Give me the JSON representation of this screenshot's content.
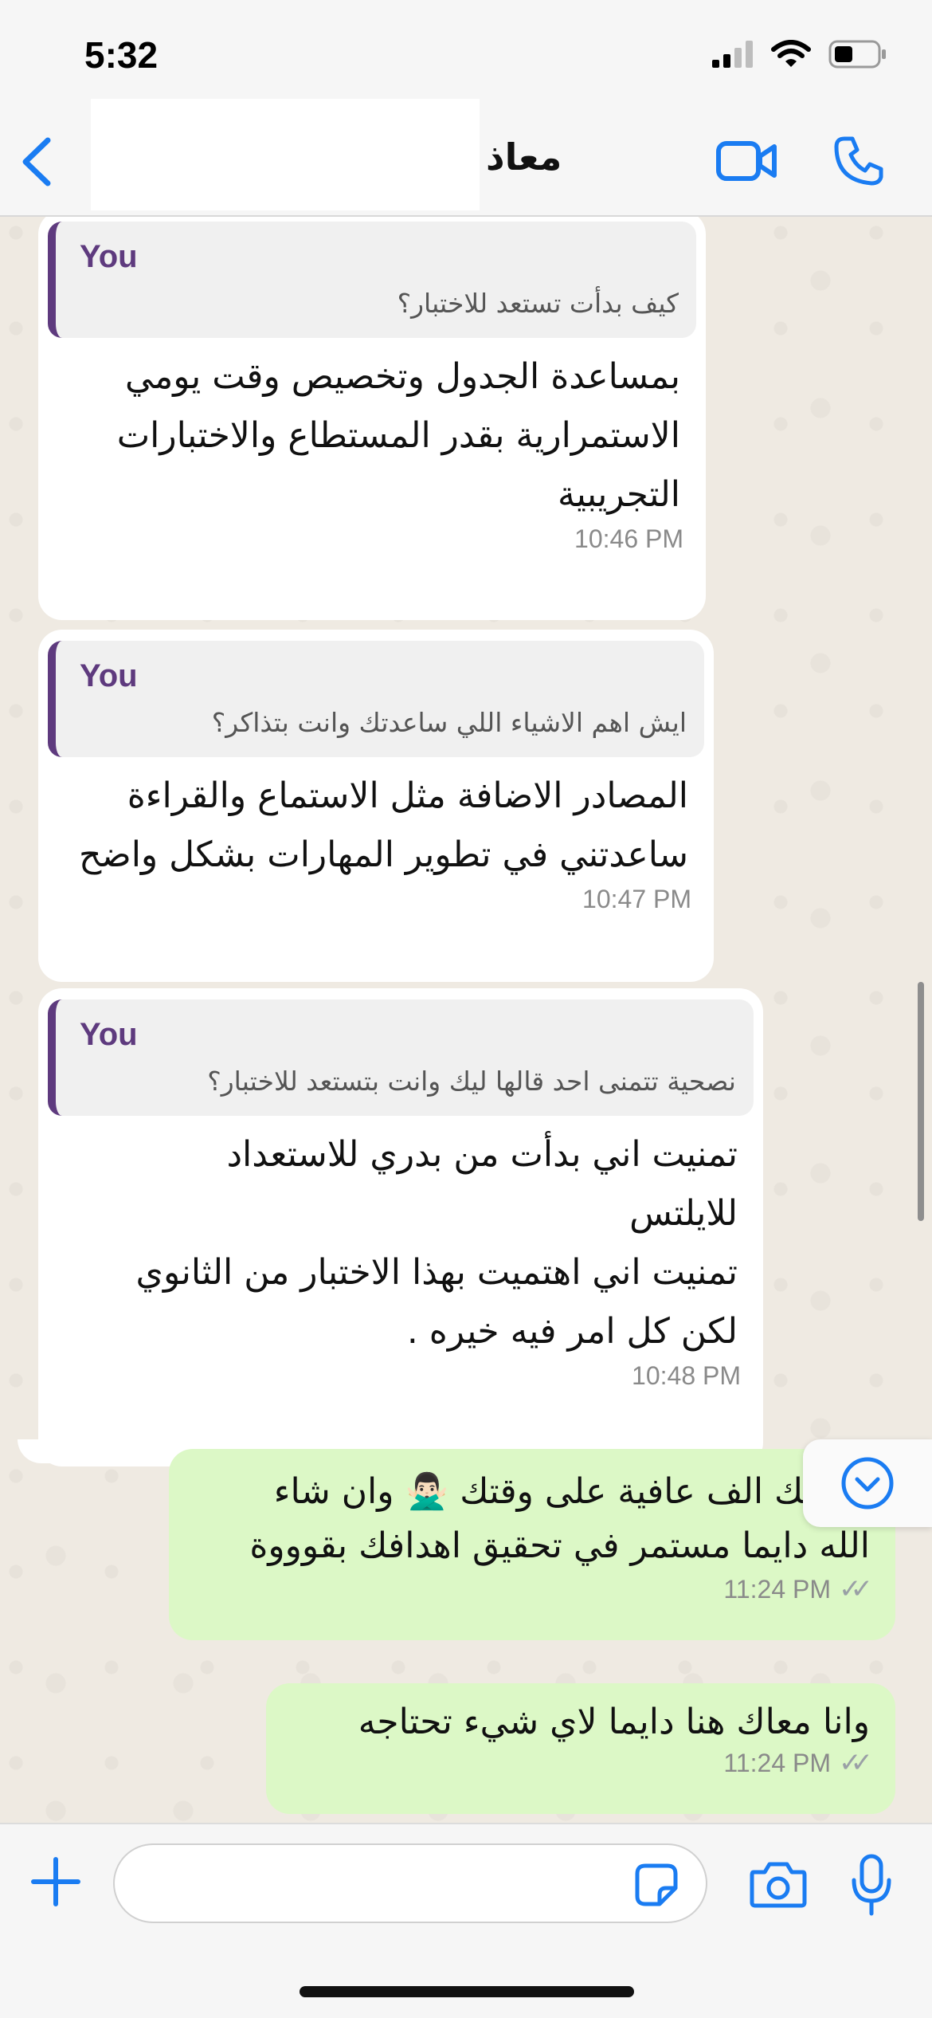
{
  "status_bar": {
    "time": "5:32"
  },
  "header": {
    "contact_name": "معاذ"
  },
  "messages": [
    {
      "direction": "incoming",
      "quote_author": "You",
      "quote_text": "كيف بدأت تستعد للاختبار؟",
      "text": "بمساعدة الجدول وتخصيص وقت يومي\nالاستمرارية بقدر المستطاع والاختبارات\nالتجريبية",
      "time": "10:46 PM"
    },
    {
      "direction": "incoming",
      "quote_author": "You",
      "quote_text": "ايش اهم الاشياء اللي ساعدتك وانت بتذاكر؟",
      "text": "المصادر الاضافة مثل الاستماع والقراءة\nساعدتني في تطوير المهارات بشكل واضح",
      "time": "10:47 PM"
    },
    {
      "direction": "incoming",
      "quote_author": "You",
      "quote_text": "نصحية تتمنى احد قالها ليك وانت بتستعد للاختبار؟",
      "text": "تمنيت اني بدأت من بدري للاستعداد\nللايلتس\nتمنيت اني اهتميت بهذا الاختبار من الثانوي\nلكن كل امر فيه خيره .",
      "time": "10:48 PM"
    },
    {
      "direction": "outgoing",
      "text": "يعطيك الف عافية على وقتك 🙅🏻‍♂️ وان شاء\nالله دايما مستمر في تحقيق اهدافك بقوووة",
      "time": "11:24 PM"
    },
    {
      "direction": "outgoing",
      "text": "وانا معاك هنا دايما لاي شيء تحتاجه",
      "time": "11:24 PM"
    }
  ],
  "input": {
    "placeholder": ""
  },
  "colors": {
    "accent": "#1a7cf2",
    "incoming_bubble": "#ffffff",
    "outgoing_bubble": "#dcf8c6",
    "quote_bar": "#5e3a7e",
    "chat_background": "#efeae2"
  },
  "icons": [
    "back-chevron",
    "video-camera",
    "phone",
    "plus",
    "sticker",
    "camera",
    "microphone",
    "scroll-down-arrow"
  ]
}
